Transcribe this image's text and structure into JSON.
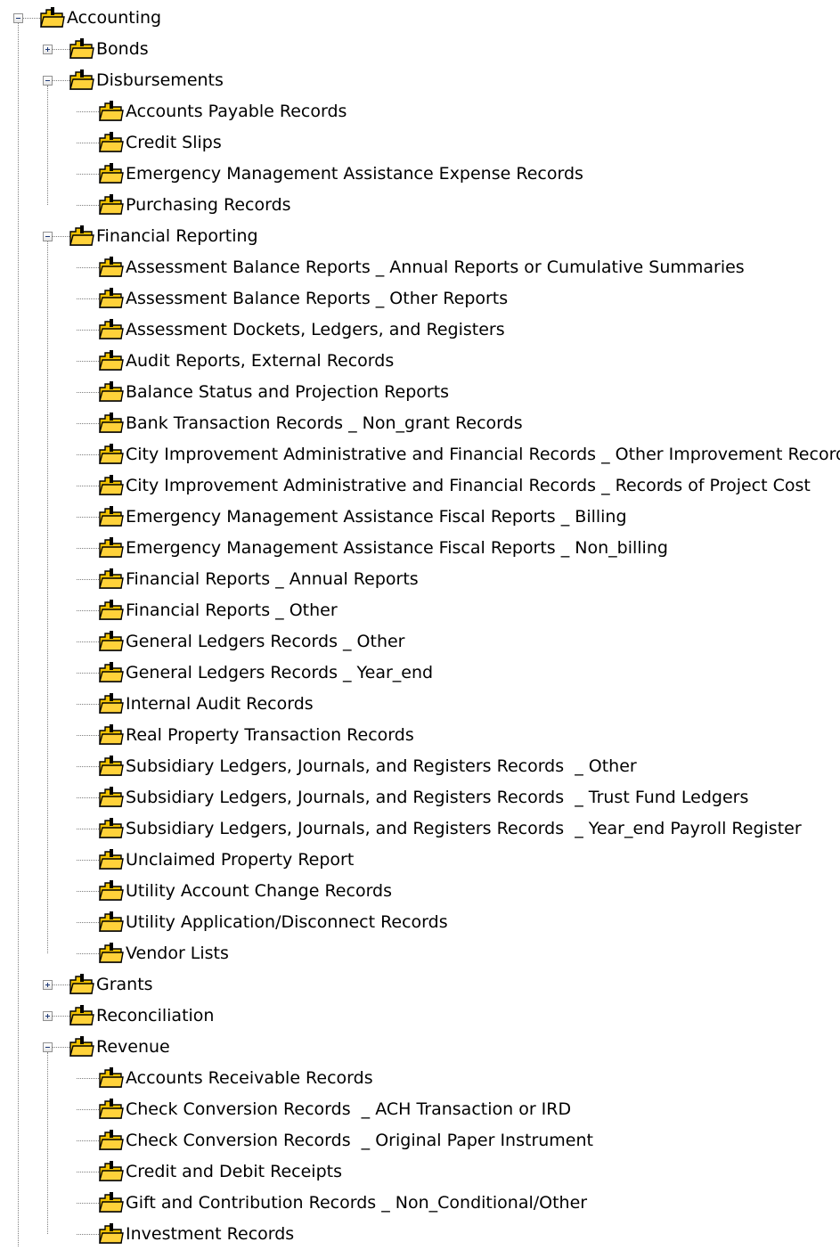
{
  "colors": {
    "guide_line": "#7f7f7f",
    "folder_fill": "#f2c200",
    "folder_outline": "#000000",
    "expander_sign": "#1f3a78"
  },
  "icons": {
    "node": "folder-icon",
    "expanded": "minus-box-icon",
    "collapsed": "plus-box-icon"
  },
  "tree": {
    "root": {
      "label": "Accounting",
      "expanded": true,
      "children": [
        {
          "label": "Bonds",
          "expanded": false,
          "children": []
        },
        {
          "label": "Disbursements",
          "expanded": true,
          "children": [
            "Accounts Payable Records",
            "Credit Slips",
            "Emergency Management Assistance Expense Records",
            "Purchasing Records"
          ]
        },
        {
          "label": "Financial Reporting",
          "expanded": true,
          "children": [
            "Assessment Balance Reports _ Annual Reports or Cumulative Summaries",
            "Assessment Balance Reports _ Other Reports",
            "Assessment Dockets, Ledgers, and Registers",
            "Audit Reports, External Records",
            "Balance Status and Projection Reports",
            "Bank Transaction Records _ Non_grant Records",
            "City Improvement Administrative and Financial Records _ Other Improvement Records",
            "City Improvement Administrative and Financial Records _ Records of Project Cost",
            "Emergency Management Assistance Fiscal Reports _ Billing",
            "Emergency Management Assistance Fiscal Reports _ Non_billing",
            "Financial Reports _ Annual Reports",
            "Financial Reports _ Other",
            "General Ledgers Records _ Other",
            "General Ledgers Records _ Year_end",
            "Internal Audit Records",
            "Real Property Transaction Records",
            "Subsidiary Ledgers, Journals, and Registers Records  _ Other",
            "Subsidiary Ledgers, Journals, and Registers Records  _ Trust Fund Ledgers",
            "Subsidiary Ledgers, Journals, and Registers Records  _ Year_end Payroll Register",
            "Unclaimed Property Report",
            "Utility Account Change Records",
            "Utility Application/Disconnect Records",
            "Vendor Lists"
          ]
        },
        {
          "label": "Grants",
          "expanded": false,
          "children": []
        },
        {
          "label": "Reconciliation",
          "expanded": false,
          "children": []
        },
        {
          "label": "Revenue",
          "expanded": true,
          "children": [
            "Accounts Receivable Records",
            "Check Conversion Records  _ ACH Transaction or IRD",
            "Check Conversion Records  _ Original Paper Instrument",
            "Credit and Debit Receipts",
            "Gift and Contribution Records _ Non_Conditional/Other",
            "Investment Records"
          ]
        }
      ]
    }
  }
}
